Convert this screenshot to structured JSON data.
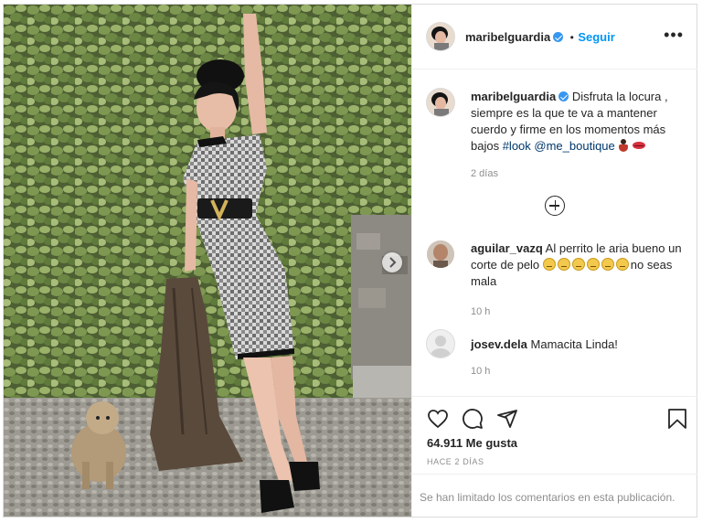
{
  "post": {
    "username": "maribelguardia",
    "follow_separator": "•",
    "follow_label": "Seguir",
    "more_icon_glyph": "•••"
  },
  "caption": {
    "username": "maribelguardia",
    "text": "Disfruta la locura , siempre es la que te va a mantener cuerdo y firme en los momentos más bajos ",
    "hashtag": "#look",
    "mention": "@me_boutique",
    "emojis": [
      "dancer-emoji",
      "kiss-lips-emoji"
    ],
    "time": "2 días"
  },
  "comments": [
    {
      "username": "aguilar_vazq",
      "text_before": "Al perrito le aria bueno un corte de pelo ",
      "emoji_count": 6,
      "text_after": "no seas mala",
      "time": "10 h"
    },
    {
      "username": "josev.dela",
      "text": "Mamacita Linda!",
      "time": "10 h"
    }
  ],
  "engagement": {
    "likes": "64.911 Me gusta",
    "timestamp": "HACE 2 DÍAS"
  },
  "footer": {
    "notice": "Se han limitado los comentarios en esta publicación."
  },
  "icons": {
    "like": "heart-icon",
    "comment": "comment-bubble-icon",
    "share": "paper-plane-icon",
    "save": "bookmark-icon",
    "next": "chevron-right-icon",
    "load_more": "plus-circle-icon"
  },
  "colors": {
    "follow": "#0095f6",
    "verified": "#3897f0",
    "meta": "#8e8e8e"
  }
}
